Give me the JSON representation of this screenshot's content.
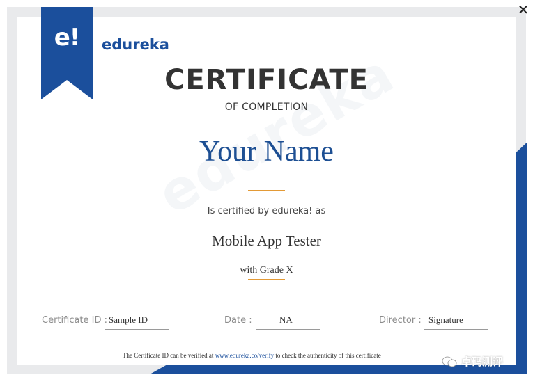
{
  "logo": {
    "mark": "e!",
    "brand": "edureka"
  },
  "watermark": "edureka",
  "certificate": {
    "title": "CERTIFICATE",
    "subtitle": "OF COMPLETION",
    "recipient_name": "Your Name",
    "certified_by": "Is certified by edureka! as",
    "course": "Mobile App Tester",
    "grade": "with Grade X"
  },
  "fields": {
    "certificate_id": {
      "label": "Certificate ID :",
      "value": "Sample ID"
    },
    "date": {
      "label": "Date :",
      "value": "NA"
    },
    "director": {
      "label": "Director :",
      "value": "Signature"
    }
  },
  "footnote": {
    "prefix": "The Certificate ID can be verified at",
    "link": "www.edureka.co/verify",
    "suffix": "to check the authenticity of this certificate"
  },
  "overlay": {
    "wechat_text": "卓码测评"
  },
  "colors": {
    "brand_blue": "#1b4f9c",
    "accent_orange": "#e39a36",
    "frame_gray": "#e9eaec"
  },
  "icons": {
    "close": "close-icon",
    "wechat": "wechat-icon"
  }
}
